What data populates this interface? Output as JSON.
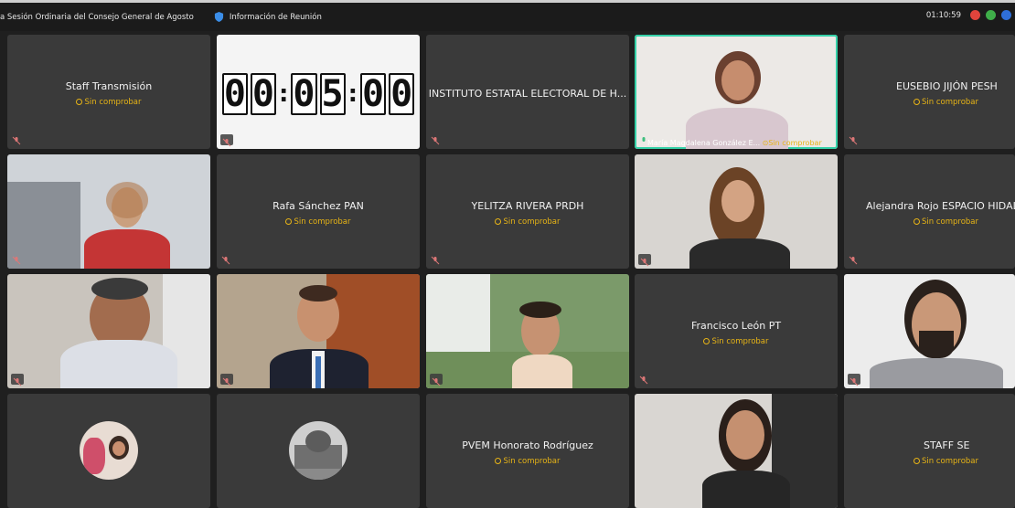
{
  "header": {
    "meeting_title": "a Sesión Ordinaria del Consejo General de Agosto",
    "info_label": "Información de Reunión",
    "elapsed_time": "01:10:59"
  },
  "timer": [
    "0",
    "0",
    ":",
    "0",
    "5",
    ":",
    "0",
    "0"
  ],
  "status_text": "Sin comprobar",
  "tiles": {
    "staff_transmision": "Staff Transmisión",
    "instituto": "INSTITUTO ESTATAL ELECTORAL DE H...",
    "maria": "María Magdalena González E...",
    "eusebio": "EUSEBIO JIJÓN PESH",
    "rafa": "Rafa Sánchez PAN",
    "yelitza": "YELITZA RIVERA PRDH",
    "alejandra": "Alejandra Rojo ESPACIO HIDALG",
    "francisco": "Francisco León PT",
    "pvem": "PVEM Honorato Rodríguez",
    "staff_se": "STAFF SE"
  },
  "colors": {
    "status": "#e7b416",
    "active_speaker": "#35d1a8",
    "tile_bg": "#3a3a3a"
  }
}
